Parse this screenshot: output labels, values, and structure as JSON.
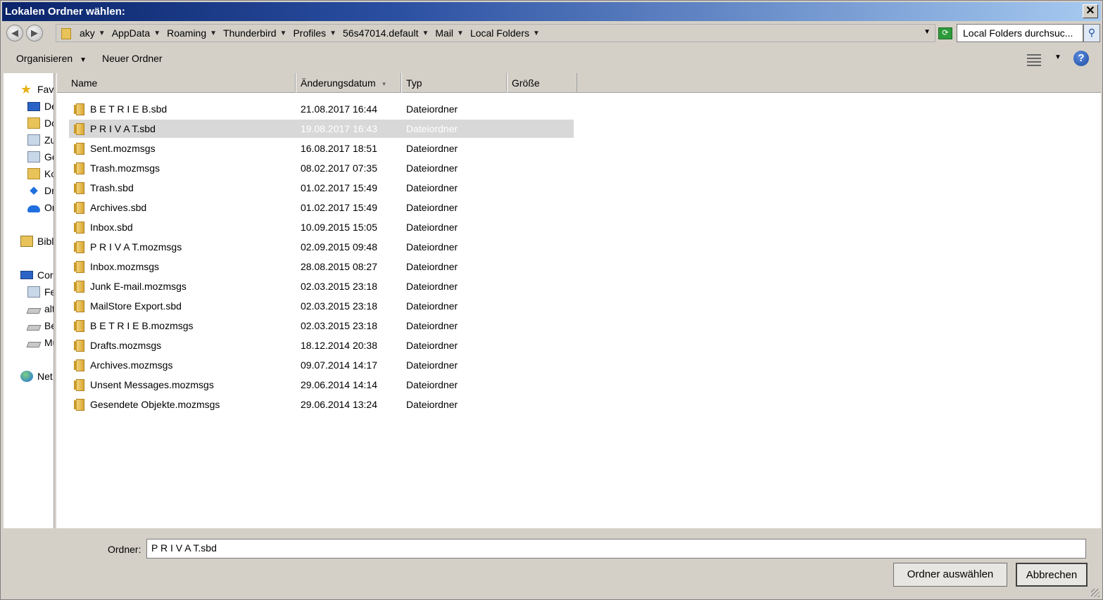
{
  "window": {
    "title": "Lokalen Ordner wählen:",
    "close_glyph": "✕"
  },
  "address": {
    "crumbs": [
      "aky",
      "AppData",
      "Roaming",
      "Thunderbird",
      "Profiles",
      "56s47014.default",
      "Mail",
      "Local Folders"
    ],
    "search_placeholder": "Local Folders durchsuc...",
    "icons": {
      "back": "arrow-left-icon",
      "forward": "arrow-right-icon",
      "refresh": "refresh-icon",
      "search": "search-icon"
    }
  },
  "toolbar": {
    "organize_label": "Organisieren",
    "new_folder_label": "Neuer Ordner",
    "help_glyph": "?"
  },
  "nav": {
    "items": [
      {
        "label": "Fav",
        "icon": "star-icon"
      },
      {
        "label": "De",
        "icon": "desktop-icon"
      },
      {
        "label": "Do",
        "icon": "downloads-folder-icon"
      },
      {
        "label": "Zu",
        "icon": "recent-places-icon"
      },
      {
        "label": "Go",
        "icon": "google-drive-icon"
      },
      {
        "label": "Ko",
        "icon": "folder-icon"
      },
      {
        "label": "Dr",
        "icon": "dropbox-icon"
      },
      {
        "label": "Or",
        "icon": "onedrive-icon"
      },
      {
        "label": "Bibli",
        "icon": "libraries-icon"
      },
      {
        "label": "Cor",
        "icon": "computer-icon"
      },
      {
        "label": "Fe",
        "icon": "network-drive-icon"
      },
      {
        "label": "alt",
        "icon": "drive-icon"
      },
      {
        "label": "Be",
        "icon": "drive-icon"
      },
      {
        "label": "Mu",
        "icon": "drive-icon"
      },
      {
        "label": "Net",
        "icon": "network-icon"
      }
    ]
  },
  "columns": {
    "name": "Name",
    "date": "Änderungsdatum",
    "type": "Typ",
    "size": "Größe"
  },
  "files": [
    {
      "name": "B E T R I E B.sbd",
      "date": "21.08.2017 16:44",
      "type": "Dateiordner",
      "selected": false
    },
    {
      "name": "P R I V A T.sbd",
      "date": "19.08.2017 16:43",
      "type": "Dateiordner",
      "selected": true
    },
    {
      "name": "Sent.mozmsgs",
      "date": "16.08.2017 18:51",
      "type": "Dateiordner",
      "selected": false
    },
    {
      "name": "Trash.mozmsgs",
      "date": "08.02.2017 07:35",
      "type": "Dateiordner",
      "selected": false
    },
    {
      "name": "Trash.sbd",
      "date": "01.02.2017 15:49",
      "type": "Dateiordner",
      "selected": false
    },
    {
      "name": "Archives.sbd",
      "date": "01.02.2017 15:49",
      "type": "Dateiordner",
      "selected": false
    },
    {
      "name": "Inbox.sbd",
      "date": "10.09.2015 15:05",
      "type": "Dateiordner",
      "selected": false
    },
    {
      "name": "P R I V A T.mozmsgs",
      "date": "02.09.2015 09:48",
      "type": "Dateiordner",
      "selected": false
    },
    {
      "name": "Inbox.mozmsgs",
      "date": "28.08.2015 08:27",
      "type": "Dateiordner",
      "selected": false
    },
    {
      "name": "Junk E-mail.mozmsgs",
      "date": "02.03.2015 23:18",
      "type": "Dateiordner",
      "selected": false
    },
    {
      "name": "MailStore Export.sbd",
      "date": "02.03.2015 23:18",
      "type": "Dateiordner",
      "selected": false
    },
    {
      "name": "B E T R I E B.mozmsgs",
      "date": "02.03.2015 23:18",
      "type": "Dateiordner",
      "selected": false
    },
    {
      "name": "Drafts.mozmsgs",
      "date": "18.12.2014 20:38",
      "type": "Dateiordner",
      "selected": false
    },
    {
      "name": "Archives.mozmsgs",
      "date": "09.07.2014 14:17",
      "type": "Dateiordner",
      "selected": false
    },
    {
      "name": "Unsent Messages.mozmsgs",
      "date": "29.06.2014 14:14",
      "type": "Dateiordner",
      "selected": false
    },
    {
      "name": "Gesendete Objekte.mozmsgs",
      "date": "29.06.2014 13:24",
      "type": "Dateiordner",
      "selected": false
    }
  ],
  "footer": {
    "folder_label": "Ordner:",
    "folder_value": "P R I V A T.sbd",
    "select_button": "Ordner auswählen",
    "cancel_button": "Abbrechen"
  }
}
